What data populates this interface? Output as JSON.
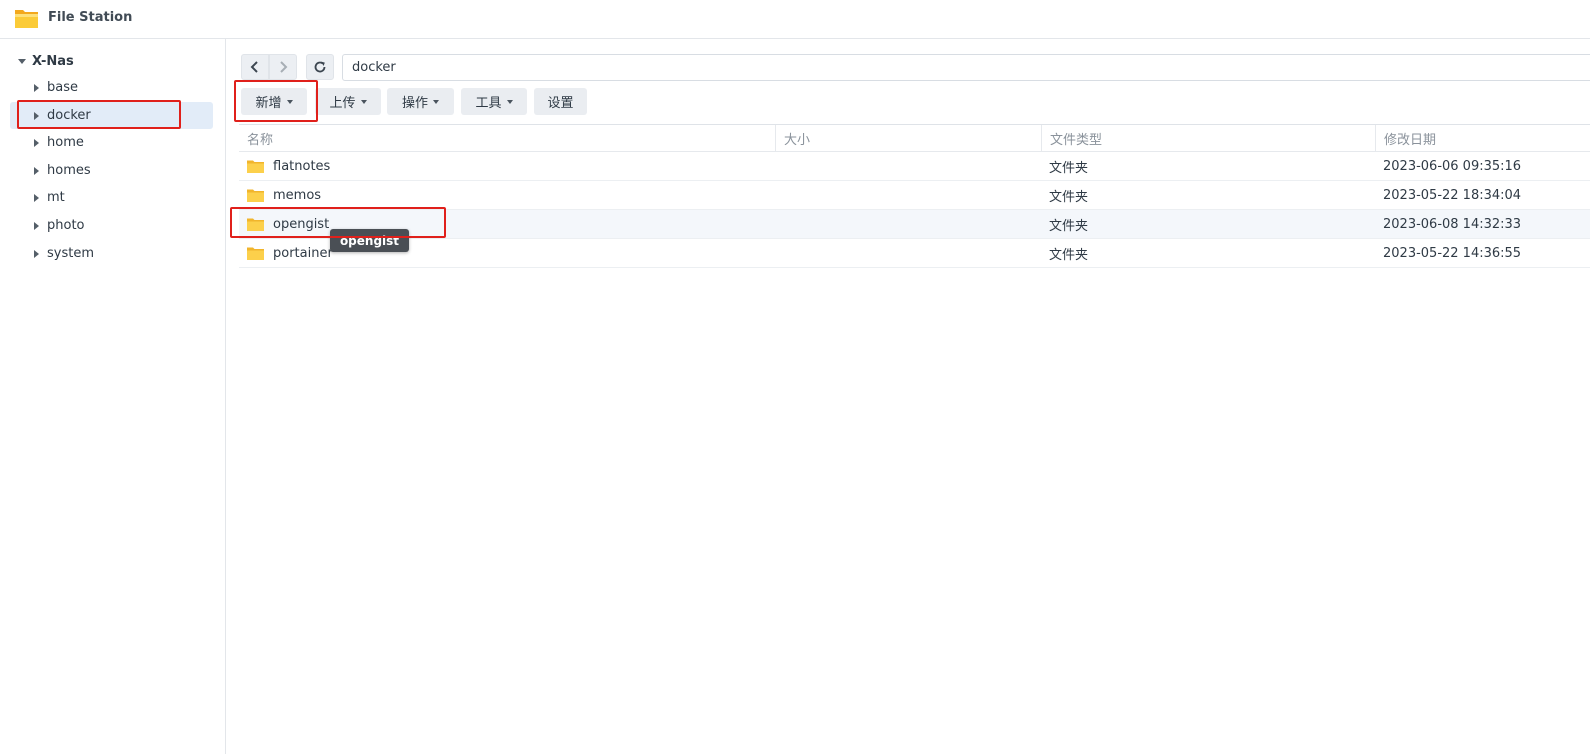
{
  "app": {
    "title": "File Station",
    "icon": "folder-icon"
  },
  "sidebar": {
    "root": "X-Nas",
    "items": [
      {
        "label": "base"
      },
      {
        "label": "docker",
        "selected": true
      },
      {
        "label": "home"
      },
      {
        "label": "homes"
      },
      {
        "label": "mt"
      },
      {
        "label": "photo"
      },
      {
        "label": "system"
      }
    ]
  },
  "nav": {
    "back": "chevron-left-icon",
    "forward": "chevron-right-icon",
    "refresh": "refresh-icon",
    "path": "docker"
  },
  "toolbar": {
    "create": "新增",
    "upload": "上传",
    "action": "操作",
    "tools": "工具",
    "settings": "设置"
  },
  "columns": {
    "name": "名称",
    "size": "大小",
    "type": "文件类型",
    "modified": "修改日期"
  },
  "files": [
    {
      "name": "flatnotes",
      "size": "",
      "type": "文件夹",
      "modified": "2023-06-06 09:35:16"
    },
    {
      "name": "memos",
      "size": "",
      "type": "文件夹",
      "modified": "2023-05-22 18:34:04"
    },
    {
      "name": "opengist",
      "size": "",
      "type": "文件夹",
      "modified": "2023-06-08 14:32:33"
    },
    {
      "name": "portainer",
      "size": "",
      "type": "文件夹",
      "modified": "2023-05-22 14:36:55"
    }
  ],
  "tooltip": "opengist",
  "colors": {
    "highlight": "#e0201b",
    "selected_bg": "#e2ecf8",
    "folder": "#f7c542"
  }
}
